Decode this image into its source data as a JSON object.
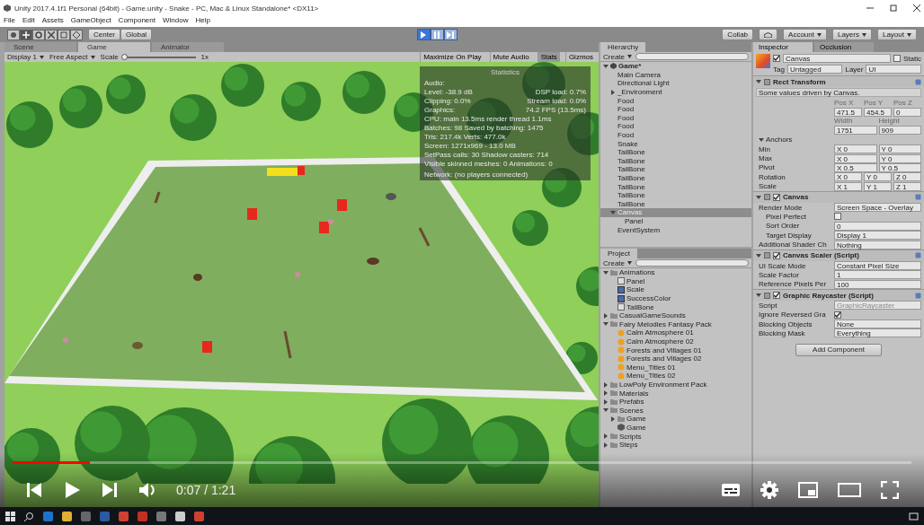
{
  "window": {
    "title": "Unity 2017.4.1f1 Personal (64bit) - Game.unity - Snake - PC, Mac & Linux Standalone* <DX11>"
  },
  "menu": [
    "File",
    "Edit",
    "Assets",
    "GameObject",
    "Component",
    "Window",
    "Help"
  ],
  "toolbar": {
    "pivot": "Center",
    "space": "Global",
    "play_buttons": [
      {
        "kind": "play",
        "selected": true
      },
      {
        "kind": "pause",
        "selected": false
      },
      {
        "kind": "step",
        "selected": false
      }
    ],
    "collab": "Collab",
    "account": "Account",
    "layers": "Layers",
    "layout": "Layout"
  },
  "view_tabs": [
    {
      "label": "Scene",
      "selected": false
    },
    {
      "label": "Game",
      "selected": true
    },
    {
      "label": "Animator",
      "selected": false
    }
  ],
  "game_bar": {
    "display": "Display 1",
    "aspect": "Free Aspect",
    "scale": {
      "label": "Scale",
      "value": "1x",
      "level": 0
    },
    "buttons": [
      {
        "label": "Maximize On Play",
        "selected": false
      },
      {
        "label": "Mute Audio",
        "selected": false
      },
      {
        "label": "Stats",
        "selected": true
      },
      {
        "label": "Gizmos",
        "selected": false
      }
    ]
  },
  "stats": {
    "title": "Statistics",
    "lines": [
      {
        "kind": "heading",
        "text": "Audio:"
      },
      {
        "kind": "pair",
        "left": "Level: -38.9 dB",
        "right": "DSP load: 0.7%"
      },
      {
        "kind": "pair",
        "left": "Clipping: 0.0%",
        "right": "Stream load: 0.0%"
      },
      {
        "kind": "pair",
        "left": "Graphics:",
        "right": "74.2 FPS (13.5ms)"
      },
      {
        "kind": "line",
        "text": "CPU: main 13.5ms  render thread 1.1ms"
      },
      {
        "kind": "line",
        "text": "Batches: 98  Saved by batching: 1475"
      },
      {
        "kind": "line",
        "text": "Tris: 217.4k  Verts: 477.0k"
      },
      {
        "kind": "line",
        "text": "Screen: 1271x969 - 13.0 MB"
      },
      {
        "kind": "line",
        "text": "SetPass calls: 30  Shadow casters: 714"
      },
      {
        "kind": "line",
        "text": "Visible skinned meshes: 0  Animations: 0"
      },
      {
        "kind": "heading",
        "text": "Network: (no players connected)"
      }
    ]
  },
  "hierarchy": {
    "title": "Hierarchy",
    "create": "Create",
    "items": [
      {
        "label": "Game*",
        "expanded": true,
        "selected": false,
        "children": [
          {
            "label": "Main Camera",
            "selected": false
          },
          {
            "label": "Directional Light",
            "selected": false
          },
          {
            "label": "_Environment",
            "expanded": false,
            "selected": false
          },
          {
            "label": "Food",
            "selected": false
          },
          {
            "label": "Food",
            "selected": false
          },
          {
            "label": "Food",
            "selected": false
          },
          {
            "label": "Food",
            "selected": false
          },
          {
            "label": "Food",
            "selected": false
          },
          {
            "label": "Snake",
            "selected": false
          },
          {
            "label": "TailBone",
            "selected": false
          },
          {
            "label": "TailBone",
            "selected": false
          },
          {
            "label": "TailBone",
            "selected": false
          },
          {
            "label": "TailBone",
            "selected": false
          },
          {
            "label": "TailBone",
            "selected": false
          },
          {
            "label": "TailBone",
            "selected": false
          },
          {
            "label": "TailBone",
            "selected": false
          },
          {
            "label": "Canvas",
            "expanded": true,
            "selected": true,
            "children": [
              {
                "label": "Panel",
                "selected": false
              }
            ]
          },
          {
            "label": "EventSystem",
            "selected": false
          }
        ]
      }
    ]
  },
  "project": {
    "title": "Project",
    "create": "Create",
    "items": [
      {
        "label": "Animations",
        "kind": "folder",
        "expanded": true,
        "children": [
          {
            "label": "Panel",
            "kind": "controller"
          },
          {
            "label": "Scale",
            "kind": "clip"
          },
          {
            "label": "SuccessColor",
            "kind": "clip"
          },
          {
            "label": "TailBone",
            "kind": "controller"
          }
        ]
      },
      {
        "label": "CasualGameSounds",
        "kind": "folder",
        "expanded": false
      },
      {
        "label": "Fairy Melodies Fantasy Pack",
        "kind": "folder",
        "expanded": true,
        "children": [
          {
            "label": "Calm Atmosphere 01",
            "kind": "audio"
          },
          {
            "label": "Calm Atmosphere 02",
            "kind": "audio"
          },
          {
            "label": "Forests and Villages 01",
            "kind": "audio"
          },
          {
            "label": "Forests and Villages 02",
            "kind": "audio"
          },
          {
            "label": "Menu_Titles 01",
            "kind": "audio"
          },
          {
            "label": "Menu_Titles 02",
            "kind": "audio"
          }
        ]
      },
      {
        "label": "LowPoly Environment Pack",
        "kind": "folder",
        "expanded": false
      },
      {
        "label": "Materials",
        "kind": "folder",
        "expanded": false
      },
      {
        "label": "Prefabs",
        "kind": "folder",
        "expanded": false
      },
      {
        "label": "Scenes",
        "kind": "folder",
        "expanded": true,
        "children": [
          {
            "label": "Game",
            "kind": "folder",
            "expanded": false
          },
          {
            "label": "Game",
            "kind": "scene"
          }
        ]
      },
      {
        "label": "Scripts",
        "kind": "folder",
        "expanded": false
      },
      {
        "label": "Steps",
        "kind": "folder",
        "expanded": false
      }
    ]
  },
  "inspector": {
    "tabs": [
      {
        "label": "Inspector",
        "selected": true
      },
      {
        "label": "Occlusion",
        "selected": false
      }
    ],
    "name": "Canvas",
    "active": true,
    "static_label": "Static",
    "static": false,
    "tag_label": "Tag",
    "tag": "Untagged",
    "layer_label": "Layer",
    "layer": "UI",
    "components": [
      {
        "title": "Rect Transform",
        "rows": [
          {
            "kind": "note",
            "text": "Some values driven by Canvas."
          },
          {
            "kind": "heads",
            "cells": [
              "Pos X",
              "Pos Y",
              "Pos Z"
            ]
          },
          {
            "kind": "vector",
            "label": "",
            "cells": [
              "471.5",
              "454.5",
              "0"
            ]
          },
          {
            "kind": "heads",
            "cells": [
              "Width",
              "Height"
            ]
          },
          {
            "kind": "vector",
            "label": "",
            "cells": [
              "1751",
              "909"
            ]
          },
          {
            "kind": "section",
            "label": "Anchors"
          },
          {
            "kind": "vector",
            "label": "Min",
            "cells": [
              "X 0",
              "Y 0"
            ]
          },
          {
            "kind": "vector",
            "label": "Max",
            "cells": [
              "X 0",
              "Y 0"
            ]
          },
          {
            "kind": "vector",
            "label": "Pivot",
            "cells": [
              "X 0.5",
              "Y 0.5"
            ]
          },
          {
            "kind": "vector",
            "label": "Rotation",
            "cells": [
              "X 0",
              "Y 0",
              "Z 0"
            ]
          },
          {
            "kind": "vector",
            "label": "Scale",
            "cells": [
              "X 1",
              "Y 1",
              "Z 1"
            ]
          }
        ]
      },
      {
        "title": "Canvas",
        "enabled": true,
        "rows": [
          {
            "kind": "field",
            "label": "Render Mode",
            "value": "Screen Space - Overlay"
          },
          {
            "kind": "check",
            "label": "Pixel Perfect",
            "checked": false,
            "sub": true
          },
          {
            "kind": "field",
            "label": "Sort Order",
            "value": "0",
            "sub": true
          },
          {
            "kind": "field",
            "label": "Target Display",
            "value": "Display 1",
            "sub": true
          },
          {
            "kind": "field",
            "label": "Additional Shader Ch",
            "value": "Nothing"
          }
        ]
      },
      {
        "title": "Canvas Scaler (Script)",
        "enabled": true,
        "rows": [
          {
            "kind": "field",
            "label": "UI Scale Mode",
            "value": "Constant Pixel Size"
          },
          {
            "kind": "field",
            "label": "Scale Factor",
            "value": "1"
          },
          {
            "kind": "field",
            "label": "Reference Pixels Per",
            "value": "100"
          }
        ]
      },
      {
        "title": "Graphic Raycaster (Script)",
        "enabled": true,
        "rows": [
          {
            "kind": "field",
            "label": "Script",
            "value": "GraphicRaycaster",
            "disabled": true
          },
          {
            "kind": "check",
            "label": "Ignore Reversed Gra",
            "checked": true
          },
          {
            "kind": "field",
            "label": "Blocking Objects",
            "value": "None"
          },
          {
            "kind": "field",
            "label": "Blocking Mask",
            "value": "Everything"
          }
        ]
      }
    ],
    "add_component": "Add Component"
  },
  "player": {
    "level": 0.086,
    "time": "0:07 / 1:21"
  }
}
